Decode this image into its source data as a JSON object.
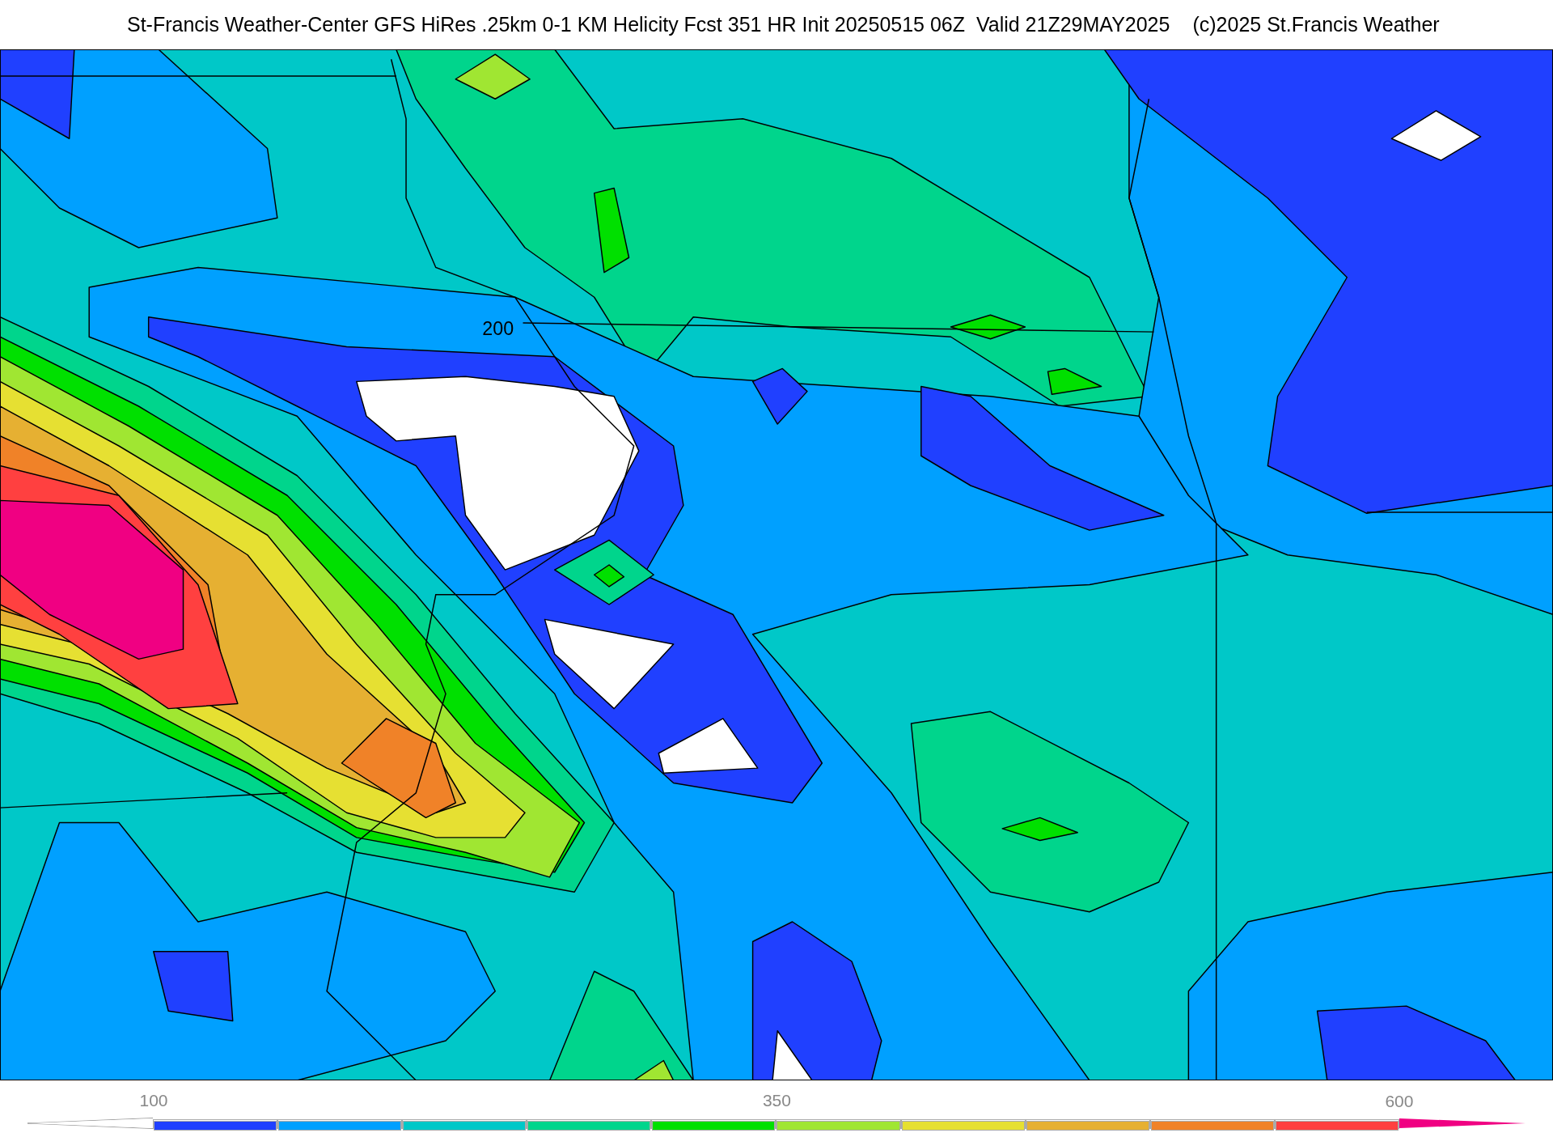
{
  "title": "St-Francis Weather-Center GFS HiRes .25km 0-1 KM Helicity Fcst 351 HR Init 20250515 06Z  Valid 21Z29MAY2025",
  "copyright": "(c)2025 St.Francis Weather",
  "map": {
    "contour_label": "200"
  },
  "colorbar": [
    {
      "kind": "left-end",
      "color": "#ffffff"
    },
    {
      "kind": "band",
      "color": "#2040ff",
      "label": "100"
    },
    {
      "kind": "band",
      "color": "#00a0ff"
    },
    {
      "kind": "band",
      "color": "#00c8c8"
    },
    {
      "kind": "band",
      "color": "#00d58c"
    },
    {
      "kind": "band",
      "color": "#00e000"
    },
    {
      "kind": "band",
      "color": "#a0e632",
      "label": "350"
    },
    {
      "kind": "band",
      "color": "#e6e032"
    },
    {
      "kind": "band",
      "color": "#e6b032"
    },
    {
      "kind": "band",
      "color": "#f08228"
    },
    {
      "kind": "band",
      "color": "#ff4040"
    },
    {
      "kind": "right-end",
      "color": "#f00082",
      "label": "600"
    }
  ]
}
